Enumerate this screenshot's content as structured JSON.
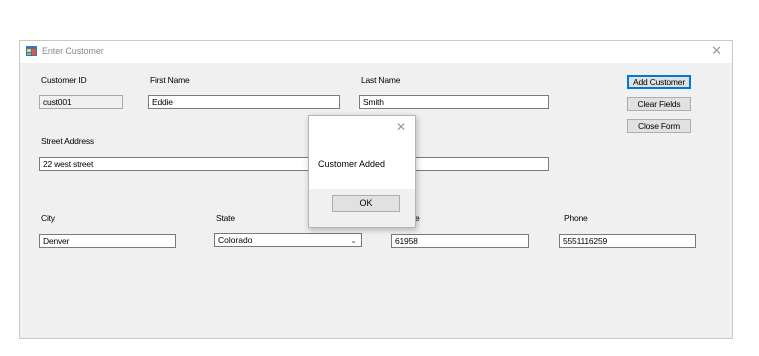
{
  "window": {
    "title": "Enter Customer",
    "close_glyph": "✕"
  },
  "fields": {
    "customer_id": {
      "label": "Customer ID",
      "value": "cust001"
    },
    "first_name": {
      "label": "First Name",
      "value": "Eddie"
    },
    "last_name": {
      "label": "Last Name",
      "value": "Smith"
    },
    "street_address": {
      "label": "Street Address",
      "value": "22 west street"
    },
    "city": {
      "label": "City",
      "value": "Denver"
    },
    "state": {
      "label": "State",
      "value": "Colorado"
    },
    "zip": {
      "label": "ode",
      "value": "61958"
    },
    "phone": {
      "label": "Phone",
      "value": "5551116259"
    }
  },
  "buttons": {
    "add": "Add Customer",
    "clear": "Clear Fields",
    "close": "Close Form"
  },
  "dialog": {
    "message": "Customer Added",
    "ok": "OK",
    "close_glyph": "✕"
  },
  "colors": {
    "accent": "#0078d7",
    "window_bg": "#f0f0f0"
  },
  "icons": {
    "app": "form-app-icon",
    "dropdown": "chevron-down-icon"
  }
}
